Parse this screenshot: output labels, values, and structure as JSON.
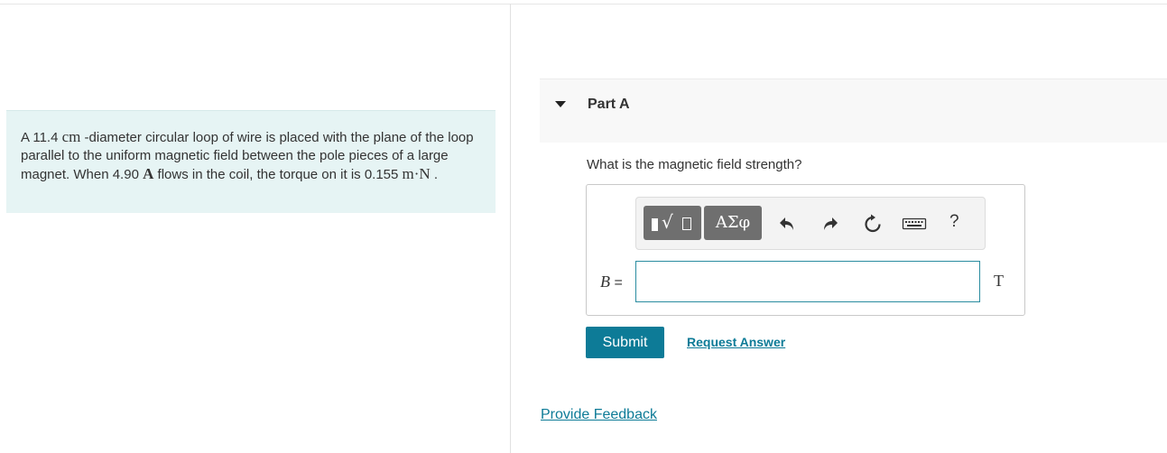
{
  "problem": {
    "prefix": "A 11.4 ",
    "diameter_unit": "cm",
    "text1": " -diameter circular loop of wire is placed with the plane of the loop parallel to the uniform magnetic field between the pole pieces of a large magnet. When 4.90 ",
    "current_unit": "A",
    "text2": " flows in the coil, the torque on it is 0.155 ",
    "torque_unit": "m·N",
    "suffix": " ."
  },
  "part": {
    "title": "Part A",
    "expanded": true
  },
  "question": "What is the magnetic field strength?",
  "toolbar": {
    "templates_icon": "templates-icon",
    "greek_label": "ΑΣφ",
    "undo_icon": "undo-icon",
    "redo_icon": "redo-icon",
    "reset_icon": "reset-icon",
    "keyboard_icon": "keyboard-icon",
    "help_label": "?"
  },
  "answer": {
    "variable": "B",
    "equals": " =",
    "value": "",
    "unit": "T"
  },
  "buttons": {
    "submit": "Submit",
    "request_answer": "Request Answer",
    "provide_feedback": "Provide Feedback"
  },
  "colors": {
    "accent": "#0d7b97",
    "problem_bg": "#e6f4f4",
    "toolbar_button": "#6f6f6f",
    "part_header_bg": "#f8f8f8"
  }
}
